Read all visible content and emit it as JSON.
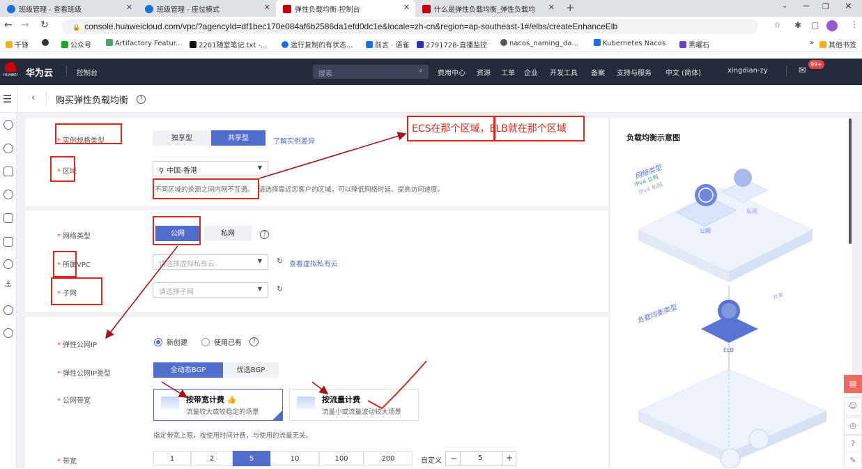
{
  "browser": {
    "tabs": [
      {
        "label": "班级管理 - 查看班级",
        "active": false
      },
      {
        "label": "班级管理 - 座位模式",
        "active": false
      },
      {
        "label": "弹性负载均衡-控制台",
        "active": true
      },
      {
        "label": "什么是弹性负载均衡_弹性负载均",
        "active": false
      }
    ],
    "url": "console.huaweicloud.com/vpc/?agencyId=df1bec170e084af6b2586da1efd0dc1e&locale=zh-cn&region=ap-southeast-1#/elbs/createEnhanceElb",
    "bookmarks": [
      "千锋",
      "公众号",
      "Artifactory Featur...",
      "2201随堂笔记.txt -...",
      "运行复制的有状态...",
      "前言 · 语雀",
      "2791728-直播监控",
      "nacos_naming_da...",
      "Kubernetes Nacos",
      "黑曜石"
    ],
    "other_bookmarks": "其他书签"
  },
  "console": {
    "brand_small": "HUAWEI",
    "brand": "华为云",
    "console_label": "控制台",
    "search_placeholder": "搜索",
    "nav": [
      "费用中心",
      "资源",
      "工单",
      "企业",
      "开发工具",
      "备案",
      "支持与服务",
      "中文 (简体)",
      "xingdian-zy"
    ],
    "msg_badge": "99+"
  },
  "page": {
    "title": "购买弹性负载均衡"
  },
  "form": {
    "spec_label": "实例规格类型",
    "spec_options": [
      "独享型",
      "共享型"
    ],
    "spec_link": "了解实例差异",
    "region_label": "区域",
    "region_value": "中国-香港",
    "region_hint_boxed": "不同区域的资源之间内网不互通。",
    "region_hint_rest": "请选择靠近您客户的区域，可以降低网络时延、提高访问速度。",
    "net_label": "网络类型",
    "net_options": [
      "公网",
      "私网"
    ],
    "vpc_label": "所属VPC",
    "vpc_placeholder": "请选择虚拟私有云",
    "vpc_link": "查看虚拟私有云",
    "subnet_label": "子网",
    "subnet_placeholder": "请选择子网",
    "eip_label": "弹性公网IP",
    "eip_options": [
      "新创建",
      "使用已有"
    ],
    "eip_type_label": "弹性公网IP类型",
    "eip_type_options": [
      "全动态BGP",
      "优选BGP"
    ],
    "bandwidth_label": "公网带宽",
    "bill_by_bandwidth_title": "按带宽计费",
    "bill_by_bandwidth_desc": "流量较大或较稳定的场景",
    "bill_by_traffic_title": "按流量计费",
    "bill_by_traffic_desc": "流量小或流量波动较大场景",
    "bandwidth_hint": "指定带宽上限，按使用时间计费，与使用的流量无关。",
    "bw_label": "带宽",
    "bw_options": [
      "1",
      "2",
      "5",
      "10",
      "100",
      "200"
    ],
    "bw_custom_label": "自定义",
    "bw_value": "5"
  },
  "annotation": {
    "note": "ECS在那个区域，ELB就在那个区域"
  },
  "diagram": {
    "title": "负载均衡示意图",
    "net_type_label": "网络类型",
    "ipv4_public": "IPv4 公网",
    "ipv4_private": "IPv4 私网",
    "public_label": "公网",
    "private_label": "私网",
    "lb_type_label": "负载均衡类型",
    "elb_label": "ELB",
    "side_label": "共享"
  }
}
